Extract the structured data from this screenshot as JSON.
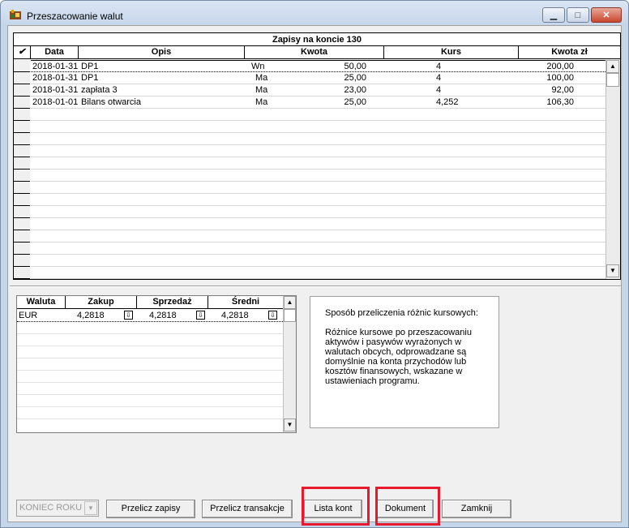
{
  "window": {
    "title": "Przeszacowanie walut",
    "minimize_glyph": "▁",
    "maximize_glyph": "□",
    "close_glyph": "✕"
  },
  "entries": {
    "caption": "Zapisy na koncie 130",
    "check_header": "✔",
    "columns": [
      "Data",
      "Opis",
      "Kwota",
      "Kurs",
      "Kwota zł"
    ],
    "rows": [
      {
        "date": "2018-01-31",
        "desc": "DP1",
        "side": "Wn",
        "amount": "50,00",
        "rate": "4",
        "amount_pln": "200,00"
      },
      {
        "date": "2018-01-31",
        "desc": "DP1",
        "side": "Ma",
        "amount": "25,00",
        "rate": "4",
        "amount_pln": "100,00"
      },
      {
        "date": "2018-01-31",
        "desc": "zapłata 3",
        "side": "Ma",
        "amount": "23,00",
        "rate": "4",
        "amount_pln": "92,00"
      },
      {
        "date": "2018-01-01",
        "desc": "Bilans otwarcia",
        "side": "Ma",
        "amount": "25,00",
        "rate": "4,252",
        "amount_pln": "106,30"
      }
    ]
  },
  "rates": {
    "columns": [
      "Waluta",
      "Zakup",
      "Sprzedaż",
      "Średni"
    ],
    "rows": [
      {
        "currency": "EUR",
        "buy": "4,2818",
        "sell": "4,2818",
        "mid": "4,2818"
      }
    ]
  },
  "info": {
    "heading": "Sposób przeliczenia różnic kursowych:",
    "body": "Różnice kursowe po przeszacowaniu aktywów i pasywów wyrażonych w walutach obcych, odprowadzane są domyślnie na konta przychodów lub kosztów finansowych, wskazane w ustawieniach programu."
  },
  "footer": {
    "period_value": "KONIEC ROKU",
    "buttons": {
      "recalc_entries": "Przelicz zapisy",
      "recalc_transactions": "Przelicz transakcje",
      "accounts_list": "Lista kont",
      "document": "Dokument",
      "close": "Zamknij"
    }
  },
  "colors": {
    "highlight": "#e8192c",
    "title_gradient_top": "#dbe6f4"
  }
}
